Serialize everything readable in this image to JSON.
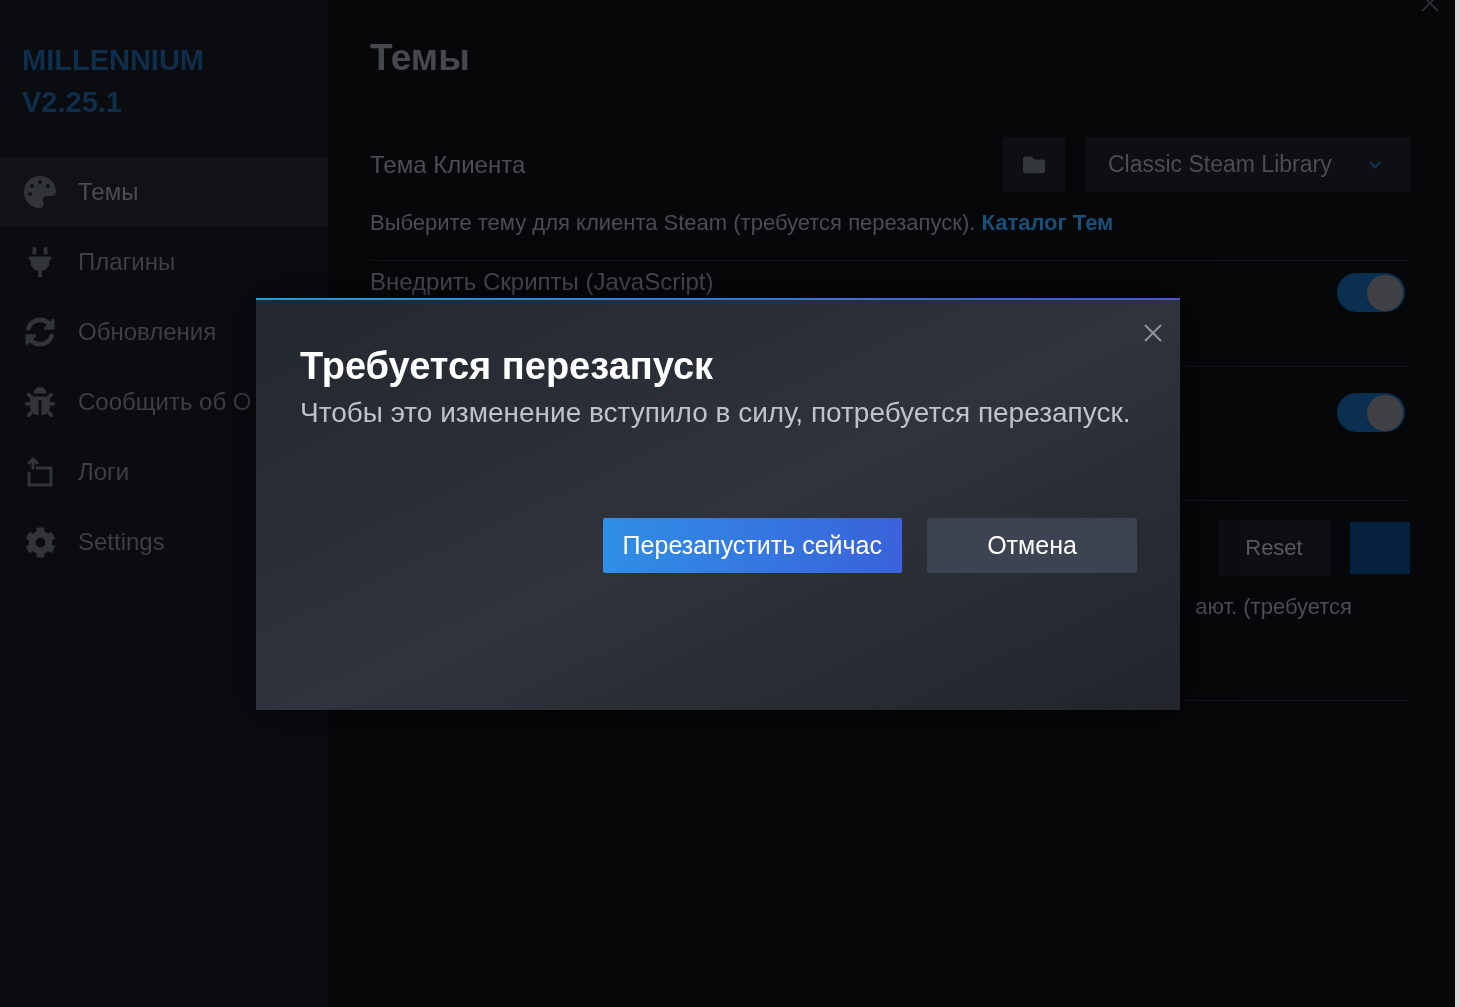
{
  "sidebar": {
    "brand": "MILLENNIUM",
    "version": "V2.25.1",
    "items": [
      {
        "label": "Темы",
        "selected": true
      },
      {
        "label": "Плагины",
        "selected": false
      },
      {
        "label": "Обновления",
        "selected": false
      },
      {
        "label": "Сообщить об О",
        "selected": false
      },
      {
        "label": "Логи",
        "selected": false
      },
      {
        "label": "Settings",
        "selected": false
      }
    ]
  },
  "main": {
    "title": "Темы",
    "settings": [
      {
        "kind": "select",
        "label": "Тема Клиента",
        "value": "Classic Steam Library",
        "description": "Выберите тему для клиента Steam (требуется перезапуск).",
        "link": "Каталог Тем"
      },
      {
        "kind": "toggle",
        "label": "Внедрить Скрипты (JavaScript)",
        "on": true
      },
      {
        "kind": "toggle",
        "on": true
      },
      {
        "kind": "color",
        "button": "Reset",
        "color": "#06213f",
        "description": "ают. (требуется"
      }
    ]
  },
  "dialog": {
    "title": "Требуется перезапуск",
    "message": "Чтобы это изменение вступило в силу, потребуется перезапуск.",
    "buttons": [
      {
        "kind": "primary",
        "label": "Перезапустить сейчас"
      },
      {
        "kind": "secondary",
        "label": "Отмена"
      }
    ]
  }
}
